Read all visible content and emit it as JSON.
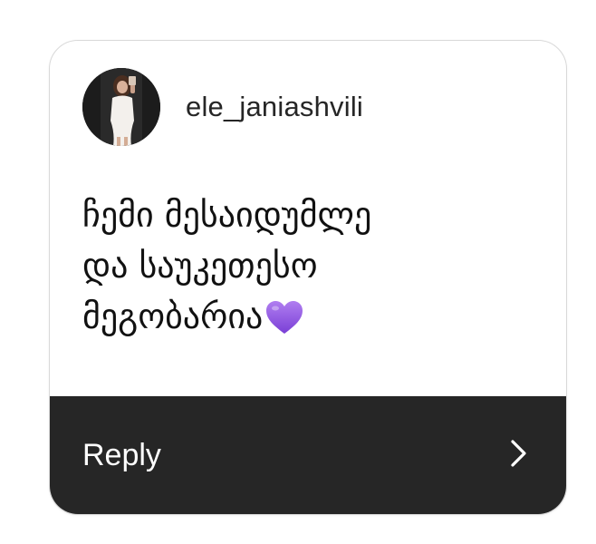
{
  "story_reply": {
    "username": "ele_janiashvili",
    "avatar_icon": "profile-photo",
    "message_lines": [
      "ჩემი მესაიდუმლე",
      "და საუკეთესო",
      "მეგობარია"
    ],
    "message_emoji": "purple-heart",
    "reply_label": "Reply",
    "reply_icon": "chevron-right-icon"
  },
  "colors": {
    "reply_bar_bg": "#262626",
    "heart": "#9b5de5",
    "text": "#111111"
  }
}
